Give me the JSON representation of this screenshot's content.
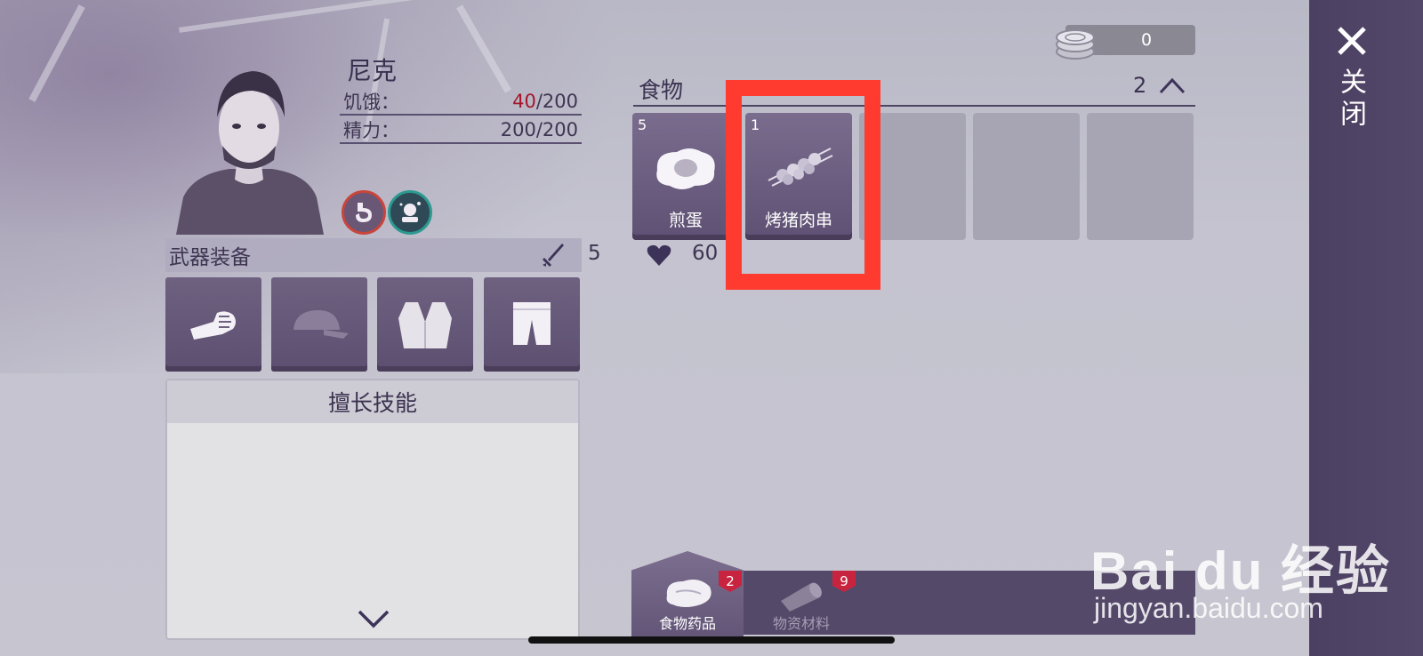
{
  "character": {
    "name": "尼克",
    "hunger_label": "饥饿：",
    "hunger_current": "40",
    "hunger_max": "/200",
    "energy_label": "精力：",
    "energy_value": "200/200"
  },
  "weapons": {
    "title": "武器装备",
    "attack": "5",
    "health": "60"
  },
  "skills": {
    "title": "擅长技能"
  },
  "currency": {
    "amount": "0"
  },
  "food": {
    "title": "食物",
    "page": "2",
    "items": [
      {
        "qty": "5",
        "label": "煎蛋"
      },
      {
        "qty": "1",
        "label": "烤猪肉串"
      }
    ]
  },
  "close": {
    "label": "关闭"
  },
  "tabs": {
    "food_medicine": {
      "label": "食物药品",
      "badge": "2"
    },
    "materials": {
      "label": "物资材料",
      "badge": "9"
    }
  },
  "watermark": {
    "brand": "Bai du 经验",
    "url": "jingyan.baidu.com"
  },
  "colors": {
    "highlight": "#ff3b30",
    "hunger_red": "#a4162a",
    "panel_purple": "#54486a"
  }
}
